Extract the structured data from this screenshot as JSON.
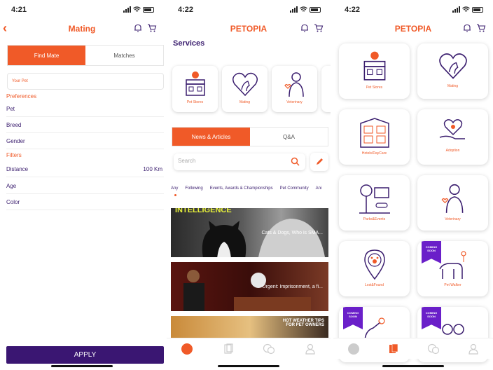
{
  "screen1": {
    "time": "4:21",
    "title": "Mating",
    "tabs": [
      "Find Mate",
      "Matches"
    ],
    "pet_placeholder": "Your Pet",
    "preferences_label": "Preferences",
    "pref_rows": [
      "Pet",
      "Breed",
      "Gender"
    ],
    "filters_label": "Filters",
    "distance_label": "Distance",
    "distance_value": "100 Km",
    "filter_rows": [
      "Age",
      "Color"
    ],
    "apply_label": "APPLY"
  },
  "screen2": {
    "time": "4:22",
    "title": "PETOPIA",
    "services_heading": "Services",
    "services": [
      "Pet Stores",
      "Mating",
      "Veterinary"
    ],
    "tabs": [
      "News & Articles",
      "Q&A"
    ],
    "search_placeholder": "Search",
    "filters": [
      "Any",
      "Following",
      "Events, Awards & Championships",
      "Pet Community",
      "Ani"
    ],
    "news": [
      {
        "headline": "Cats & Dogs, Who is SMA...",
        "banner": "INTELLIGENCE"
      },
      {
        "headline": "Urgent: Imprisonment, a fi..."
      },
      {
        "banner_line1": "HOT WEATHER TIPS",
        "banner_line2": "FOR PET OWNERS"
      }
    ]
  },
  "screen3": {
    "time": "4:22",
    "title": "PETOPIA",
    "cards": [
      "Pet Stores",
      "Mating",
      "Hotels/DayCare",
      "Adoption",
      "Parks&Events",
      "Veterinary",
      "Lost&Found",
      "Pet Walker",
      "",
      ""
    ],
    "coming_soon": "COMING SOON"
  },
  "colors": {
    "accent": "#f05a28",
    "primary": "#3a1672",
    "text": "#3a1d6e",
    "ribbon": "#6a1fc9"
  }
}
